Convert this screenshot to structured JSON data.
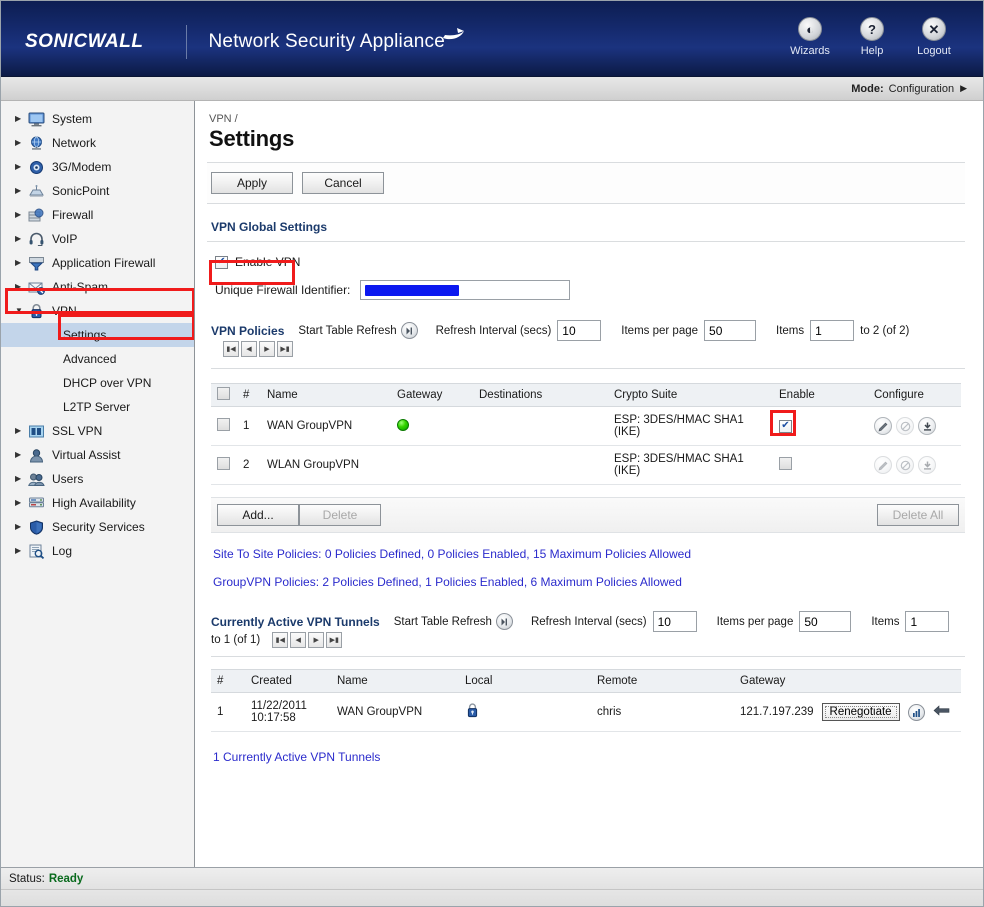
{
  "banner": {
    "logo_text": "SONICWALL",
    "product_title": "Network Security Appliance",
    "actions": [
      {
        "label": "Wizards",
        "icon": "wizard-icon",
        "glyph": "◐"
      },
      {
        "label": "Help",
        "icon": "help-icon",
        "glyph": "?"
      },
      {
        "label": "Logout",
        "icon": "logout-icon",
        "glyph": "✕"
      }
    ]
  },
  "modebar": {
    "mode_label": "Mode:",
    "mode_value": "Configuration",
    "caret": "▶"
  },
  "sidebar": {
    "items": [
      {
        "label": "System",
        "icon": "monitor-icon",
        "expanded": false
      },
      {
        "label": "Network",
        "icon": "globe-icon",
        "expanded": false
      },
      {
        "label": "3G/Modem",
        "icon": "modem-icon",
        "expanded": false
      },
      {
        "label": "SonicPoint",
        "icon": "access-point-icon",
        "expanded": false
      },
      {
        "label": "Firewall",
        "icon": "firewall-icon",
        "expanded": false
      },
      {
        "label": "VoIP",
        "icon": "headset-icon",
        "expanded": false
      },
      {
        "label": "Application Firewall",
        "icon": "app-firewall-icon",
        "expanded": false
      },
      {
        "label": "Anti-Spam",
        "icon": "antispam-icon",
        "expanded": false
      },
      {
        "label": "VPN",
        "icon": "lock-icon",
        "expanded": true
      },
      {
        "label": "SSL VPN",
        "icon": "sslvpn-icon",
        "expanded": false
      },
      {
        "label": "Virtual Assist",
        "icon": "user-icon",
        "expanded": false
      },
      {
        "label": "Users",
        "icon": "users-icon",
        "expanded": false
      },
      {
        "label": "High Availability",
        "icon": "server-stack-icon",
        "expanded": false
      },
      {
        "label": "Security Services",
        "icon": "shield-icon",
        "expanded": false
      },
      {
        "label": "Log",
        "icon": "log-search-icon",
        "expanded": false
      }
    ],
    "vpn_subitems": [
      {
        "label": "Settings",
        "active": true
      },
      {
        "label": "Advanced",
        "active": false
      },
      {
        "label": "DHCP over VPN",
        "active": false
      },
      {
        "label": "L2TP Server",
        "active": false
      }
    ]
  },
  "page": {
    "breadcrumb": "VPN /",
    "title": "Settings",
    "apply_label": "Apply",
    "cancel_label": "Cancel"
  },
  "global_settings": {
    "heading": "VPN Global Settings",
    "enable_vpn_label": "Enable VPN",
    "enable_vpn_checked": true,
    "identifier_label": "Unique Firewall Identifier:",
    "identifier_value": ""
  },
  "policies_toolbar": {
    "title": "VPN Policies",
    "start_refresh_label": "Start Table Refresh",
    "refresh_interval_label": "Refresh Interval (secs)",
    "refresh_interval_value": "10",
    "items_per_page_label": "Items per page",
    "items_per_page_value": "50",
    "items_label": "Items",
    "items_from_value": "1",
    "items_range_text": "to 2 (of 2)",
    "pager": [
      "⏮",
      "◀",
      "▶",
      "⏭"
    ]
  },
  "policies_table": {
    "columns": [
      "",
      "#",
      "Name",
      "Gateway",
      "Destinations",
      "Crypto Suite",
      "Enable",
      "Configure"
    ],
    "rows": [
      {
        "num": "1",
        "name": "WAN GroupVPN",
        "gateway_status": "active",
        "destinations": "",
        "crypto_line1": "ESP: 3DES/HMAC SHA1",
        "crypto_line2": "(IKE)",
        "enabled": true
      },
      {
        "num": "2",
        "name": "WLAN GroupVPN",
        "gateway_status": "none",
        "destinations": "",
        "crypto_line1": "ESP: 3DES/HMAC SHA1",
        "crypto_line2": "(IKE)",
        "enabled": false
      }
    ]
  },
  "policies_actions": {
    "add_label": "Add...",
    "delete_label": "Delete",
    "delete_all_label": "Delete All"
  },
  "policy_summary": {
    "site_to_site": "Site To Site Policies: 0 Policies Defined, 0 Policies Enabled, 15 Maximum Policies Allowed",
    "group_vpn": "GroupVPN Policies: 2 Policies Defined, 1 Policies Enabled, 6 Maximum Policies Allowed"
  },
  "tunnels_toolbar": {
    "title": "Currently Active VPN Tunnels",
    "start_refresh_label": "Start Table Refresh",
    "refresh_interval_label": "Refresh Interval (secs)",
    "refresh_interval_value": "10",
    "items_per_page_label": "Items per page",
    "items_per_page_value": "50",
    "items_label": "Items",
    "items_from_value": "1",
    "items_range_text": "to 1 (of 1)",
    "pager": [
      "⏮",
      "◀",
      "▶",
      "⏭"
    ]
  },
  "tunnels_table": {
    "columns": [
      "#",
      "Created",
      "Name",
      "Local",
      "Remote",
      "Gateway",
      ""
    ],
    "rows": [
      {
        "num": "1",
        "created_line1": "11/22/2011",
        "created_line2": "10:17:58",
        "name": "WAN GroupVPN",
        "local_icon": "lock-icon",
        "remote": "chris",
        "gateway": "121.7.197.239",
        "renegotiate_label": "Renegotiate"
      }
    ]
  },
  "tunnels_footer_link": "1 Currently Active VPN Tunnels",
  "statusbar": {
    "label": "Status:",
    "value": "Ready"
  },
  "colors": {
    "banner_blue": "#152a6e",
    "accent_heading": "#1b3a6b",
    "link_blue": "#2b2bcc",
    "status_green": "#0a6b1e",
    "annotation_red": "#f01b1b",
    "redaction_blue": "#0b18f0",
    "active_dot_green": "#35d400",
    "selected_nav_bg": "#c3d5ea"
  }
}
